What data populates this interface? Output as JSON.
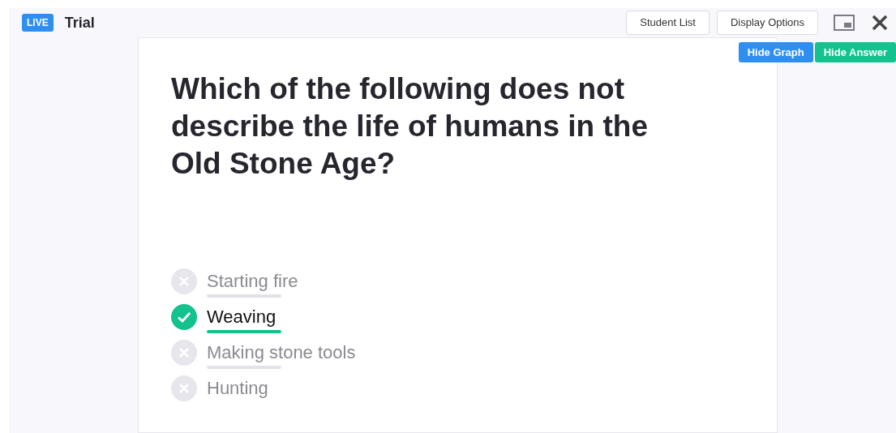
{
  "header": {
    "badge": "LIVE",
    "title": "Trial",
    "buttons": [
      "Student List",
      "Display Options"
    ]
  },
  "toggles": [
    {
      "label": "Hide Graph",
      "kind": "graph"
    },
    {
      "label": "Hide Answer",
      "kind": "answer"
    }
  ],
  "question": "Which of the following does not describe the life of humans in the Old Stone Age?",
  "options": [
    {
      "label": "Starting fire",
      "correct": false,
      "bar": true
    },
    {
      "label": "Weaving",
      "correct": true,
      "bar": true
    },
    {
      "label": "Making stone tools",
      "correct": false,
      "bar": true
    },
    {
      "label": "Hunting",
      "correct": false,
      "bar": false
    }
  ]
}
